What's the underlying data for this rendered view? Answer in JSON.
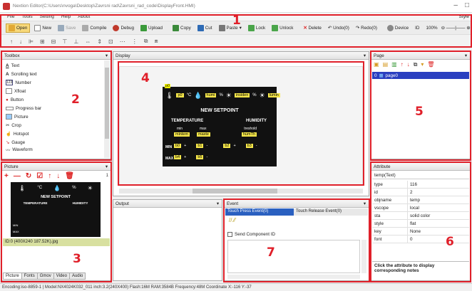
{
  "window": {
    "title": "Nextion Editor(C:\\Users\\nvoga\\Desktop\\Zavrsni rad\\Zavrsni_rad_code\\DisplayFront.HMI)"
  },
  "menu": {
    "items": [
      "File",
      "Tools",
      "Setting",
      "Help",
      "About"
    ],
    "style_label": "Style"
  },
  "toolbar": {
    "open": "Open",
    "new": "New",
    "save": "Save",
    "compile": "Compile",
    "debug": "Debug",
    "upload": "Upload",
    "copy": "Copy",
    "cut": "Cut",
    "paste": "Paste",
    "lock": "Lock",
    "unlock": "Unlock",
    "delete": "Delete",
    "undo": "Undo(0)",
    "redo": "Redo(0)",
    "device": "Device",
    "id": "ID",
    "zoom": "100%"
  },
  "toolbox": {
    "title": "Toolbox",
    "items": [
      "Text",
      "Scrolling text",
      "Number",
      "Xfloat",
      "Button",
      "Progress bar",
      "Picture",
      "Crop",
      "Hotspot",
      "Gauge",
      "Waveform"
    ]
  },
  "picture": {
    "title": "Picture",
    "count": "1",
    "item_label": "ID:0  (400X240 187.52K).jpg",
    "tabs": [
      "Picture",
      "Fonts",
      "Gmov",
      "Video",
      "Audio"
    ]
  },
  "display": {
    "title": "Display",
    "page_label": "p0",
    "screen": {
      "unit_c": "°C",
      "unit_pct": "%",
      "unit_pct2": "%",
      "humi_tag": "humi",
      "insidehum": "insiden",
      "lumi": "lumin",
      "title": "NEW SETPOINT",
      "col_temp": "TEMPERATURE",
      "col_humi": "HUMIDITY",
      "min": "min",
      "max": "max",
      "treshold": "treshold",
      "mintemp": "mintem",
      "maxtemp": "maxte",
      "humth": "humTh",
      "row_min": "MIN",
      "row_max": "MAX",
      "b0": "b0",
      "b1": "b1",
      "b2": "b2",
      "b3": "b3",
      "b4": "b4",
      "b5": "b5",
      "plus": "+",
      "minus": "-"
    }
  },
  "page_panel": {
    "title": "Page",
    "pages": [
      "page0"
    ],
    "page_index": "0"
  },
  "output": {
    "title": "Output"
  },
  "event": {
    "title": "Event",
    "tabs": [
      "Touch Press Event(0)",
      "Touch Release Event(0)"
    ],
    "checkbox": "Send Component ID"
  },
  "attribute": {
    "title": "Attribute",
    "component": "temp(Text)",
    "rows": [
      {
        "k": "type",
        "v": "116"
      },
      {
        "k": "id",
        "v": "2"
      },
      {
        "k": "objname",
        "v": "temp"
      },
      {
        "k": "vscope",
        "v": "local"
      },
      {
        "k": "sta",
        "v": "solid color"
      },
      {
        "k": "style",
        "v": "flat"
      },
      {
        "k": "key",
        "v": "None"
      },
      {
        "k": "font",
        "v": "0"
      }
    ],
    "note": "Click the attribute to display corresponding notes"
  },
  "labels": {
    "n1": "1",
    "n2": "2",
    "n3": "3",
    "n4": "4",
    "n5": "5",
    "n6": "6",
    "n7": "7"
  },
  "status": "Encoding:iso-8859-1 | Model:NX4024K032_011 inch:3.2(240X400) Flash:16M RAM:3584B Frequency:48M    Coordinate X:-116  Y:-37"
}
